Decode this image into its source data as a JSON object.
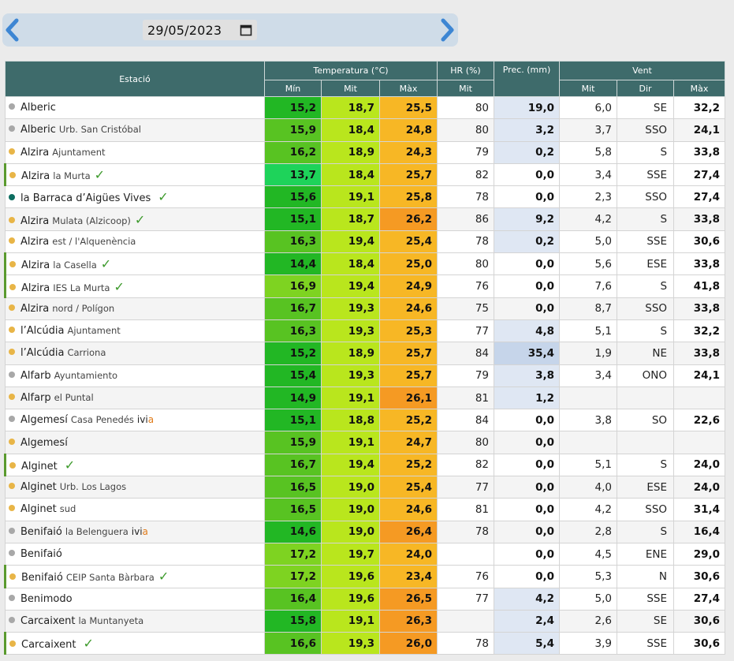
{
  "date": {
    "value": "29/05/2023"
  },
  "header": {
    "station": "Estació",
    "temperature": "Temperatura (°C)",
    "humidity": "HR (%)",
    "precip": "Prec. (mm)",
    "wind": "Vent",
    "min": "Mín",
    "mit": "Mit",
    "max": "Màx",
    "hr_mit": "Mit",
    "w_mit": "Mit",
    "w_dir": "Dir",
    "w_max": "Màx"
  },
  "colors": {
    "check": "#3d9a2c",
    "dot_gray": "#a8a8a8",
    "dot_yellow": "#e8b547",
    "dot_teal": "#0d6d60"
  },
  "rows": [
    {
      "name": "Alberic",
      "sub": "",
      "dot": "gray",
      "check": false,
      "hl": false,
      "ivia": false,
      "min": "15,2",
      "mit": "18,7",
      "max": "25,5",
      "hr": "80",
      "prec": "19,0",
      "wmit": "6,0",
      "wdir": "SE",
      "wmax": "32,2"
    },
    {
      "name": "Alberic",
      "sub": "Urb. San Cristóbal",
      "dot": "gray",
      "check": false,
      "hl": false,
      "ivia": false,
      "min": "15,9",
      "mit": "18,4",
      "max": "24,8",
      "hr": "80",
      "prec": "3,2",
      "wmit": "3,7",
      "wdir": "SSO",
      "wmax": "24,1"
    },
    {
      "name": "Alzira",
      "sub": "Ajuntament",
      "dot": "yellow",
      "check": false,
      "hl": false,
      "ivia": false,
      "min": "16,2",
      "mit": "18,9",
      "max": "24,3",
      "hr": "79",
      "prec": "0,2",
      "wmit": "5,8",
      "wdir": "S",
      "wmax": "33,8"
    },
    {
      "name": "Alzira",
      "sub": "la Murta",
      "dot": "yellow",
      "check": true,
      "hl": true,
      "ivia": false,
      "min": "13,7",
      "mit": "18,4",
      "max": "25,7",
      "hr": "82",
      "prec": "0,0",
      "wmit": "3,4",
      "wdir": "SSE",
      "wmax": "27,4"
    },
    {
      "name": "la Barraca d’Aigües Vives",
      "sub": "",
      "dot": "teal",
      "check": true,
      "hl": false,
      "ivia": false,
      "min": "15,6",
      "mit": "19,1",
      "max": "25,8",
      "hr": "78",
      "prec": "0,0",
      "wmit": "2,3",
      "wdir": "SSO",
      "wmax": "27,4"
    },
    {
      "name": "Alzira",
      "sub": "Mulata (Alzicoop)",
      "dot": "yellow",
      "check": true,
      "hl": false,
      "ivia": false,
      "min": "15,1",
      "mit": "18,7",
      "max": "26,2",
      "hr": "86",
      "prec": "9,2",
      "wmit": "4,2",
      "wdir": "S",
      "wmax": "33,8"
    },
    {
      "name": "Alzira",
      "sub": "est / l'Alquenència",
      "dot": "yellow",
      "check": false,
      "hl": false,
      "ivia": false,
      "min": "16,3",
      "mit": "19,4",
      "max": "25,4",
      "hr": "78",
      "prec": "0,2",
      "wmit": "5,0",
      "wdir": "SSE",
      "wmax": "30,6"
    },
    {
      "name": "Alzira",
      "sub": "la Casella",
      "dot": "yellow",
      "check": true,
      "hl": true,
      "ivia": false,
      "min": "14,4",
      "mit": "18,4",
      "max": "25,0",
      "hr": "80",
      "prec": "0,0",
      "wmit": "5,6",
      "wdir": "ESE",
      "wmax": "33,8"
    },
    {
      "name": "Alzira",
      "sub": "IES La Murta",
      "dot": "yellow",
      "check": true,
      "hl": true,
      "ivia": false,
      "min": "16,9",
      "mit": "19,4",
      "max": "24,9",
      "hr": "76",
      "prec": "0,0",
      "wmit": "7,6",
      "wdir": "S",
      "wmax": "41,8"
    },
    {
      "name": "Alzira",
      "sub": "nord / Polígon",
      "dot": "yellow",
      "check": false,
      "hl": false,
      "ivia": false,
      "min": "16,7",
      "mit": "19,3",
      "max": "24,6",
      "hr": "75",
      "prec": "0,0",
      "wmit": "8,7",
      "wdir": "SSO",
      "wmax": "33,8"
    },
    {
      "name": "l’Alcúdia",
      "sub": "Ajuntament",
      "dot": "yellow",
      "check": false,
      "hl": false,
      "ivia": false,
      "min": "16,3",
      "mit": "19,3",
      "max": "25,3",
      "hr": "77",
      "prec": "4,8",
      "wmit": "5,1",
      "wdir": "S",
      "wmax": "32,2"
    },
    {
      "name": "l’Alcúdia",
      "sub": "Carriona",
      "dot": "yellow",
      "check": false,
      "hl": false,
      "ivia": false,
      "min": "15,2",
      "mit": "18,9",
      "max": "25,7",
      "hr": "84",
      "prec": "35,4",
      "wmit": "1,9",
      "wdir": "NE",
      "wmax": "33,8"
    },
    {
      "name": "Alfarb",
      "sub": "Ayuntamiento",
      "dot": "gray",
      "check": false,
      "hl": false,
      "ivia": false,
      "min": "15,4",
      "mit": "19,3",
      "max": "25,7",
      "hr": "79",
      "prec": "3,8",
      "wmit": "3,4",
      "wdir": "ONO",
      "wmax": "24,1"
    },
    {
      "name": "Alfarp",
      "sub": "el Puntal",
      "dot": "yellow",
      "check": false,
      "hl": false,
      "ivia": false,
      "min": "14,9",
      "mit": "19,1",
      "max": "26,1",
      "hr": "81",
      "prec": "1,2",
      "wmit": "",
      "wdir": "",
      "wmax": ""
    },
    {
      "name": "Algemesí",
      "sub": "Casa Penedés",
      "dot": "gray",
      "check": false,
      "hl": false,
      "ivia": true,
      "min": "15,1",
      "mit": "18,8",
      "max": "25,2",
      "hr": "84",
      "prec": "0,0",
      "wmit": "3,8",
      "wdir": "SO",
      "wmax": "22,6"
    },
    {
      "name": "Algemesí",
      "sub": "",
      "dot": "yellow",
      "check": false,
      "hl": false,
      "ivia": false,
      "min": "15,9",
      "mit": "19,1",
      "max": "24,7",
      "hr": "80",
      "prec": "0,0",
      "wmit": "",
      "wdir": "",
      "wmax": ""
    },
    {
      "name": "Alginet",
      "sub": "",
      "dot": "yellow",
      "check": true,
      "hl": true,
      "ivia": false,
      "min": "16,7",
      "mit": "19,4",
      "max": "25,2",
      "hr": "82",
      "prec": "0,0",
      "wmit": "5,1",
      "wdir": "S",
      "wmax": "24,0"
    },
    {
      "name": "Alginet",
      "sub": "Urb. Los Lagos",
      "dot": "yellow",
      "check": false,
      "hl": false,
      "ivia": false,
      "min": "16,5",
      "mit": "19,0",
      "max": "25,4",
      "hr": "77",
      "prec": "0,0",
      "wmit": "4,0",
      "wdir": "ESE",
      "wmax": "24,0"
    },
    {
      "name": "Alginet",
      "sub": "sud",
      "dot": "yellow",
      "check": false,
      "hl": false,
      "ivia": false,
      "min": "16,5",
      "mit": "19,0",
      "max": "24,6",
      "hr": "81",
      "prec": "0,0",
      "wmit": "4,2",
      "wdir": "SSO",
      "wmax": "31,4"
    },
    {
      "name": "Benifaió",
      "sub": "la Belenguera",
      "dot": "gray",
      "check": false,
      "hl": false,
      "ivia": true,
      "min": "14,6",
      "mit": "19,0",
      "max": "26,4",
      "hr": "78",
      "prec": "0,0",
      "wmit": "2,8",
      "wdir": "S",
      "wmax": "16,4"
    },
    {
      "name": "Benifaió",
      "sub": "",
      "dot": "gray",
      "check": false,
      "hl": false,
      "ivia": false,
      "min": "17,2",
      "mit": "19,7",
      "max": "24,0",
      "hr": "",
      "prec": "0,0",
      "wmit": "4,5",
      "wdir": "ENE",
      "wmax": "29,0"
    },
    {
      "name": "Benifaió",
      "sub": "CEIP Santa Bàrbara",
      "dot": "yellow",
      "check": true,
      "hl": true,
      "ivia": false,
      "min": "17,2",
      "mit": "19,6",
      "max": "23,4",
      "hr": "76",
      "prec": "0,0",
      "wmit": "5,3",
      "wdir": "N",
      "wmax": "30,6"
    },
    {
      "name": "Benimodo",
      "sub": "",
      "dot": "gray",
      "check": false,
      "hl": false,
      "ivia": false,
      "min": "16,4",
      "mit": "19,6",
      "max": "26,5",
      "hr": "77",
      "prec": "4,2",
      "wmit": "5,0",
      "wdir": "SSE",
      "wmax": "27,4"
    },
    {
      "name": "Carcaixent",
      "sub": "la Muntanyeta",
      "dot": "gray",
      "check": false,
      "hl": false,
      "ivia": false,
      "min": "15,8",
      "mit": "19,1",
      "max": "26,3",
      "hr": "",
      "prec": "2,4",
      "wmit": "2,6",
      "wdir": "SE",
      "wmax": "30,6"
    },
    {
      "name": "Carcaixent",
      "sub": "",
      "dot": "yellow",
      "check": true,
      "hl": true,
      "ivia": false,
      "min": "16,6",
      "mit": "19,3",
      "max": "26,0",
      "hr": "78",
      "prec": "5,4",
      "wmit": "3,9",
      "wdir": "SSE",
      "wmax": "30,6"
    }
  ]
}
